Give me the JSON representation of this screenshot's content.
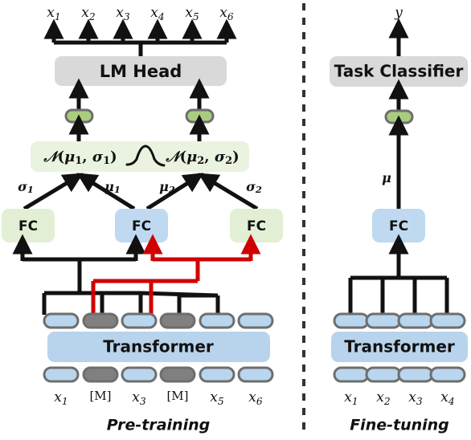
{
  "figure": {
    "title": "Pre-training and Fine-tuning architecture diagram",
    "divider": "vertical-dashed-line"
  },
  "colors": {
    "gray_box": "#d9d9d9",
    "blue_box": "#bfd9f0",
    "green_box": "#e2efd4",
    "dist_box": "#eaf3e0",
    "green_pill": "#a9cd7f",
    "blue_pill": "#b9d6ee",
    "mask_pill": "#808080",
    "pill_border": "#6e6e6e",
    "line_black": "#111111",
    "line_red": "#d00000",
    "background": "#ffffff"
  },
  "pretraining": {
    "caption": "Pre-training",
    "outputs": [
      {
        "base": "x",
        "sub": "1"
      },
      {
        "base": "x",
        "sub": "2"
      },
      {
        "base": "x",
        "sub": "3"
      },
      {
        "base": "x",
        "sub": "4"
      },
      {
        "base": "x",
        "sub": "5"
      },
      {
        "base": "x",
        "sub": "6"
      }
    ],
    "lm_head_label": "LM Head",
    "latent_pills": [
      "latent-z1",
      "latent-z2"
    ],
    "distribution": {
      "left": "N(μ₁, σ₁)",
      "right": "N(μ₂, σ₂)",
      "curve": "gaussian-bell-curve",
      "left_parts": {
        "cal": "𝒩",
        "mu": "μ",
        "mu_sub": "1",
        "sigma": "σ",
        "sigma_sub": "1"
      },
      "right_parts": {
        "cal": "𝒩",
        "mu": "μ",
        "mu_sub": "2",
        "sigma": "σ",
        "sigma_sub": "2"
      }
    },
    "param_labels": [
      {
        "sym": "σ",
        "sub": "1"
      },
      {
        "sym": "μ",
        "sub": "1"
      },
      {
        "sym": "μ",
        "sub": "2"
      },
      {
        "sym": "σ",
        "sub": "2"
      }
    ],
    "fc_blocks": [
      {
        "label": "FC",
        "variant": "green"
      },
      {
        "label": "FC",
        "variant": "blue"
      },
      {
        "label": "FC",
        "variant": "green"
      }
    ],
    "transformer_label": "Transformer",
    "hidden_tokens": [
      "visible",
      "masked",
      "visible",
      "masked",
      "visible",
      "visible"
    ],
    "input_tokens": [
      {
        "type": "visible",
        "label_base": "x",
        "label_sub": "1"
      },
      {
        "type": "masked",
        "label_base": "[M]",
        "label_sub": ""
      },
      {
        "type": "visible",
        "label_base": "x",
        "label_sub": "3"
      },
      {
        "type": "masked",
        "label_base": "[M]",
        "label_sub": ""
      },
      {
        "type": "visible",
        "label_base": "x",
        "label_sub": "5"
      },
      {
        "type": "visible",
        "label_base": "x",
        "label_sub": "6"
      }
    ]
  },
  "finetuning": {
    "caption": "Fine-tuning",
    "output": {
      "base": "y",
      "sub": ""
    },
    "task_classifier_label": "Task Classifier",
    "latent_pill": "latent-z",
    "param_label": {
      "sym": "μ",
      "sub": ""
    },
    "fc_block": {
      "label": "FC",
      "variant": "blue"
    },
    "transformer_label": "Transformer",
    "hidden_tokens": [
      "visible",
      "visible",
      "visible",
      "visible"
    ],
    "input_tokens": [
      {
        "type": "visible",
        "label_base": "x",
        "label_sub": "1"
      },
      {
        "type": "visible",
        "label_base": "x",
        "label_sub": "2"
      },
      {
        "type": "visible",
        "label_base": "x",
        "label_sub": "3"
      },
      {
        "type": "visible",
        "label_base": "x",
        "label_sub": "4"
      }
    ]
  }
}
